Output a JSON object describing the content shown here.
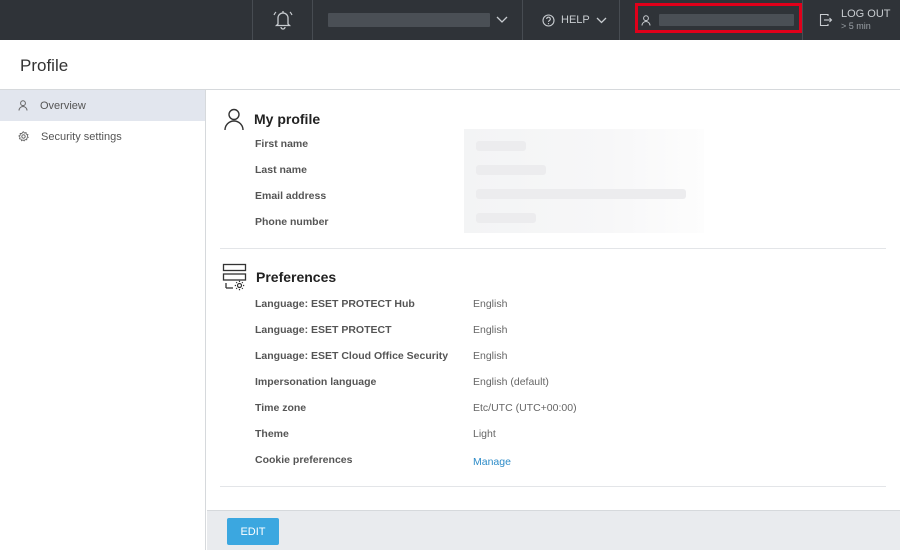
{
  "topbar": {
    "help_label": "HELP",
    "logout_label": "LOG OUT",
    "logout_timer": "> 5 min"
  },
  "page": {
    "title": "Profile"
  },
  "sidebar": {
    "items": [
      {
        "label": "Overview",
        "icon": "user-icon",
        "active": true
      },
      {
        "label": "Security settings",
        "icon": "gear-icon",
        "active": false
      }
    ]
  },
  "my_profile": {
    "title": "My profile",
    "fields": [
      {
        "label": "First name"
      },
      {
        "label": "Last name"
      },
      {
        "label": "Email address"
      },
      {
        "label": "Phone number"
      }
    ]
  },
  "preferences": {
    "title": "Preferences",
    "fields": [
      {
        "label": "Language: ESET PROTECT Hub",
        "value": "English"
      },
      {
        "label": "Language: ESET PROTECT",
        "value": "English"
      },
      {
        "label": "Language: ESET Cloud Office Security",
        "value": "English"
      },
      {
        "label": "Impersonation language",
        "value": "English (default)"
      },
      {
        "label": "Time zone",
        "value": "Etc/UTC (UTC+00:00)"
      },
      {
        "label": "Theme",
        "value": "Light"
      },
      {
        "label": "Cookie preferences",
        "value": "Manage"
      }
    ]
  },
  "footer": {
    "edit_label": "EDIT"
  },
  "colors": {
    "topbar_bg": "#2f3338",
    "accent": "#3ba7e0",
    "link": "#2e8cc8",
    "highlight": "#e0001a"
  }
}
